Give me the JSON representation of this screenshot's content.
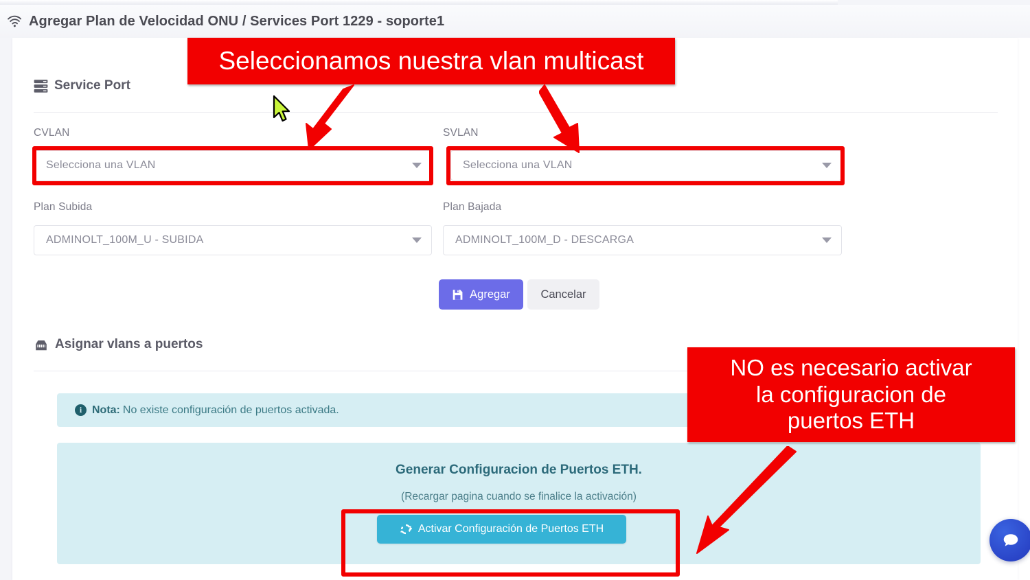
{
  "header": {
    "icon": "wifi-icon",
    "title": "Agregar Plan de Velocidad ONU / Services Port 1229 - soporte1"
  },
  "service_port": {
    "icon": "server-stack-icon",
    "heading": "Service Port",
    "fields": [
      {
        "label": "CVLAN",
        "value": "Selecciona una VLAN",
        "highlighted": "true"
      },
      {
        "label": "SVLAN",
        "value": "Selecciona una VLAN",
        "highlighted": "true"
      },
      {
        "label": "Plan Subida",
        "value": "ADMINOLT_100M_U - SUBIDA",
        "highlighted": "false"
      },
      {
        "label": "Plan Bajada",
        "value": "ADMINOLT_100M_D - DESCARGA",
        "highlighted": "false"
      }
    ],
    "submit_label": "Agregar",
    "submit_icon": "save-icon",
    "cancel_label": "Cancelar"
  },
  "assign_vlans": {
    "icon": "ethernet-port-icon",
    "heading": "Asignar vlans a puertos",
    "alert": {
      "icon": "info-icon",
      "strong": "Nota:",
      "text": "No existe configuración de puertos activada."
    },
    "eth_panel": {
      "title": "Generar Configuracion de Puertos ETH.",
      "subtitle": "(Recargar pagina cuando se finalice la activación)",
      "button_label": "Activar Configuración de Puertos ETH",
      "button_icon": "refresh-icon"
    }
  },
  "annotations": [
    {
      "text": "Seleccionamos nuestra vlan multicast",
      "color": "#f20000"
    },
    {
      "text": "NO es necesario activar la configuracion de puertos ETH",
      "color": "#f20000"
    }
  ],
  "annotation_2_lines": [
    "NO es necesario activar",
    "la configuracion de",
    "puertos ETH"
  ],
  "chat": {
    "icon": "chat-bubble-icon",
    "color": "#2a45c8"
  },
  "cursor": {
    "icon": "mouse-pointer-icon",
    "color": "#c9f53a"
  },
  "colors": {
    "accent_primary": "#6c6ce8",
    "accent_info": "#36b3d6",
    "alert_bg": "#d6eef3",
    "annotation": "#f20000",
    "page_bg": "#f4f5f9"
  }
}
